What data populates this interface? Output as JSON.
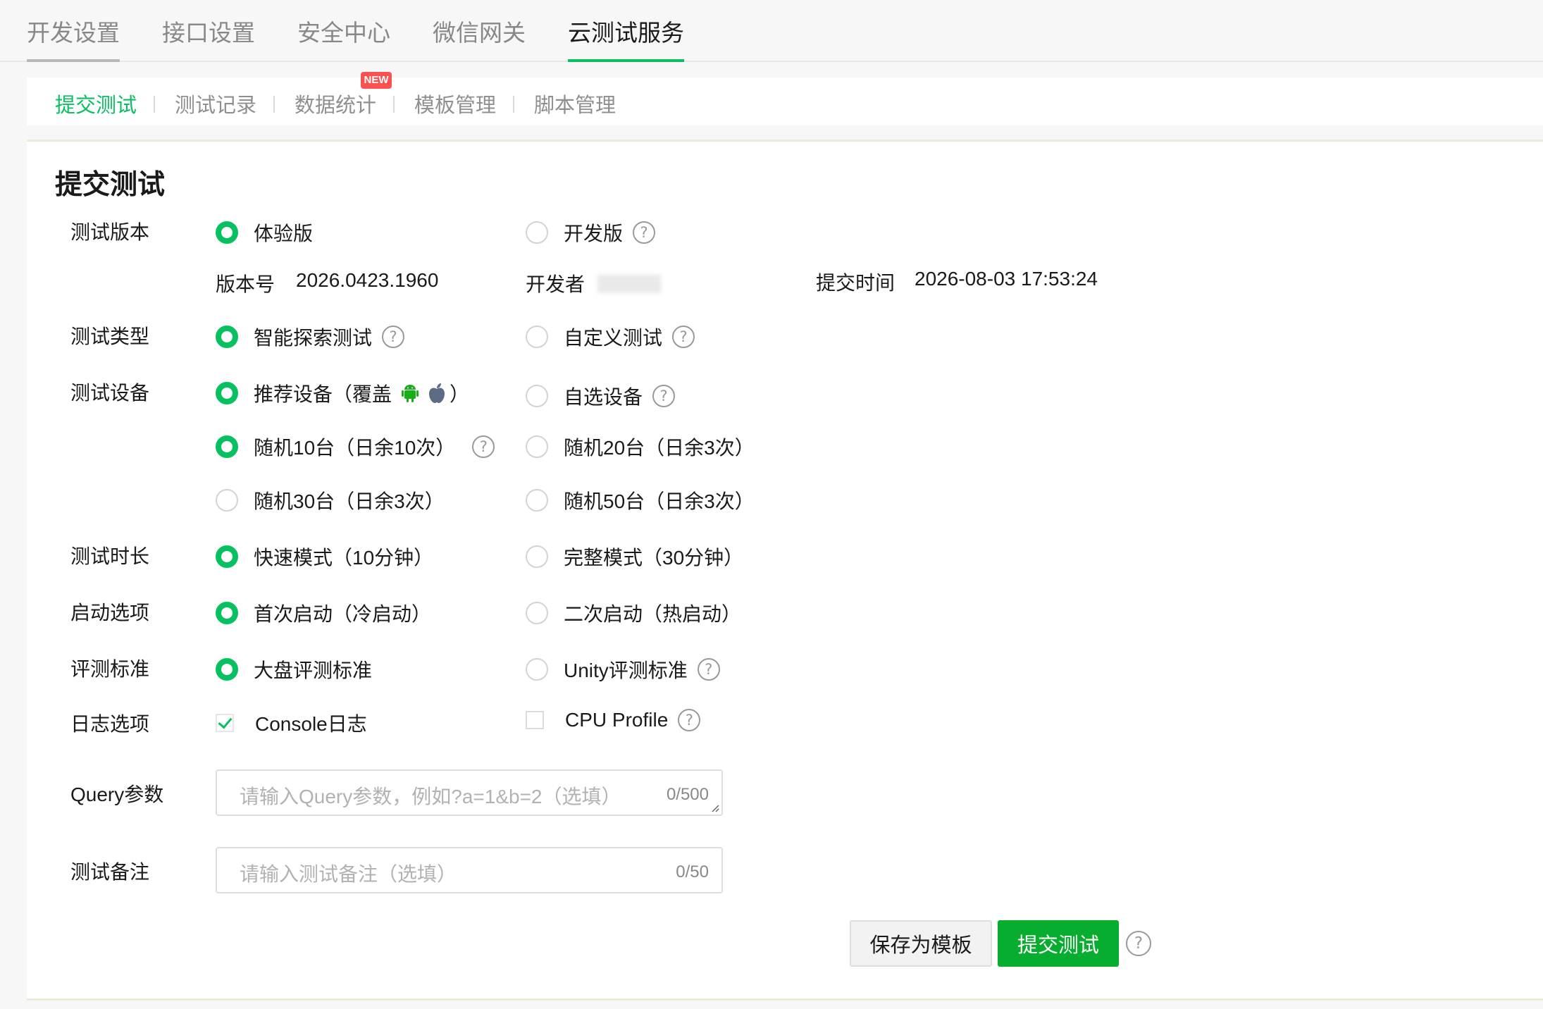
{
  "top_tabs": [
    {
      "label": "开发设置",
      "active": false
    },
    {
      "label": "接口设置",
      "active": false
    },
    {
      "label": "安全中心",
      "active": false
    },
    {
      "label": "微信网关",
      "active": false
    },
    {
      "label": "云测试服务",
      "active": true
    }
  ],
  "sub_nav": {
    "items": [
      {
        "label": "提交测试",
        "active": true
      },
      {
        "label": "测试记录",
        "active": false
      },
      {
        "label": "数据统计",
        "active": false
      },
      {
        "label": "模板管理",
        "active": false
      },
      {
        "label": "脚本管理",
        "active": false
      }
    ],
    "badge": "NEW"
  },
  "form": {
    "title": "提交测试",
    "version": {
      "label": "测试版本",
      "options": [
        {
          "label": "体验版",
          "checked": true
        },
        {
          "label": "开发版",
          "checked": false,
          "help": true
        }
      ],
      "version_no_label": "版本号",
      "version_no": "2026.0423.1960",
      "developer_label": "开发者",
      "submit_time_label": "提交时间",
      "submit_time": "2026-08-03 17:53:24"
    },
    "test_type": {
      "label": "测试类型",
      "options": [
        {
          "label": "智能探索测试",
          "checked": true,
          "help": true
        },
        {
          "label": "自定义测试",
          "checked": false,
          "help": true
        }
      ]
    },
    "device": {
      "label": "测试设备",
      "recommended": {
        "label_prefix": "推荐设备（覆盖",
        "label_suffix": "）",
        "checked": true
      },
      "custom": {
        "label": "自选设备",
        "checked": false,
        "help": true
      },
      "random_options": [
        {
          "label": "随机10台（日余10次）",
          "checked": true,
          "help": true
        },
        {
          "label": "随机20台（日余3次）",
          "checked": false
        },
        {
          "label": "随机30台（日余3次）",
          "checked": false
        },
        {
          "label": "随机50台（日余3次）",
          "checked": false
        }
      ]
    },
    "duration": {
      "label": "测试时长",
      "options": [
        {
          "label": "快速模式（10分钟）",
          "checked": true
        },
        {
          "label": "完整模式（30分钟）",
          "checked": false
        }
      ]
    },
    "launch": {
      "label": "启动选项",
      "options": [
        {
          "label": "首次启动（冷启动）",
          "checked": true
        },
        {
          "label": "二次启动（热启动）",
          "checked": false
        }
      ]
    },
    "criteria": {
      "label": "评测标准",
      "options": [
        {
          "label": "大盘评测标准",
          "checked": true
        },
        {
          "label": "Unity评测标准",
          "checked": false,
          "help": true
        }
      ]
    },
    "logs": {
      "label": "日志选项",
      "options": [
        {
          "label": "Console日志",
          "checked": true
        },
        {
          "label": "CPU Profile",
          "checked": false,
          "help": true
        }
      ]
    },
    "query": {
      "label": "Query参数",
      "placeholder": "请输入Query参数，例如?a=1&b=2（选填）",
      "count": "0/500"
    },
    "note": {
      "label": "测试备注",
      "placeholder": "请输入测试备注（选填）",
      "count": "0/50"
    }
  },
  "buttons": {
    "save_template": "保存为模板",
    "submit": "提交测试"
  },
  "help_glyph": "?",
  "colors": {
    "brand_green": "#07c160",
    "primary_button": "#07ad2f",
    "badge_red": "#fa5151"
  }
}
